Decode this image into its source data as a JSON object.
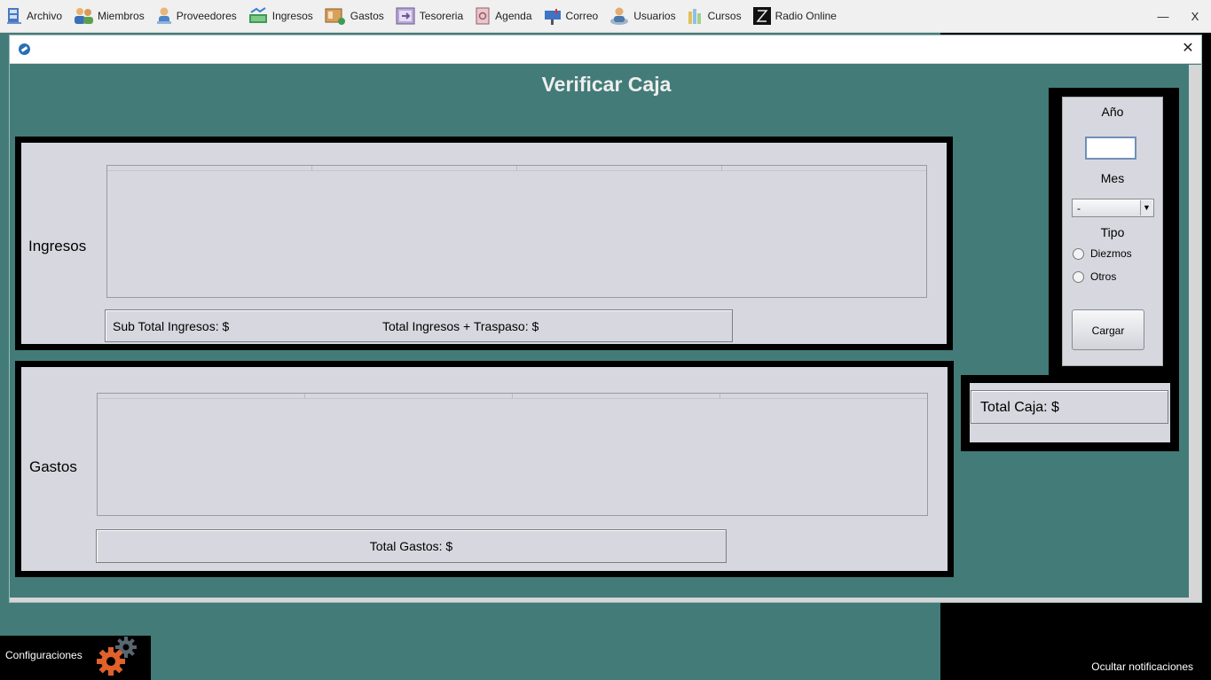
{
  "menubar": {
    "items": [
      {
        "label": "Archivo",
        "icon": "file-cabinet-icon"
      },
      {
        "label": "Miembros",
        "icon": "members-icon"
      },
      {
        "label": "Proveedores",
        "icon": "provider-icon"
      },
      {
        "label": "Ingresos",
        "icon": "money-in-icon"
      },
      {
        "label": "Gastos",
        "icon": "expenses-icon"
      },
      {
        "label": "Tesoreria",
        "icon": "treasury-icon"
      },
      {
        "label": "Agenda",
        "icon": "agenda-icon"
      },
      {
        "label": "Correo",
        "icon": "mail-icon"
      },
      {
        "label": "Usuarios",
        "icon": "users-icon"
      },
      {
        "label": "Cursos",
        "icon": "courses-icon"
      },
      {
        "label": "Radio Online",
        "icon": "radio-icon"
      }
    ],
    "minimize": "—",
    "close": "X"
  },
  "window": {
    "close": "✕",
    "title": "Verificar Caja"
  },
  "ingresos": {
    "label": "Ingresos",
    "subtotal": "Sub Total Ingresos: $",
    "total": "Total Ingresos + Traspaso: $"
  },
  "gastos": {
    "label": "Gastos",
    "total": "Total Gastos: $"
  },
  "filter": {
    "year_label": "Año",
    "year_value": "",
    "month_label": "Mes",
    "month_value": "-",
    "type_label": "Tipo",
    "option_diezmos": "Diezmos",
    "option_otros": "Otros",
    "load_button": "Cargar"
  },
  "total_caja": "Total Caja: $",
  "footer": {
    "config": "Configuraciones",
    "hide_notifications": "Ocultar notificaciones"
  },
  "colors": {
    "background": "#437b78",
    "panel": "#d7d8df",
    "gear_orange": "#e0612a"
  }
}
